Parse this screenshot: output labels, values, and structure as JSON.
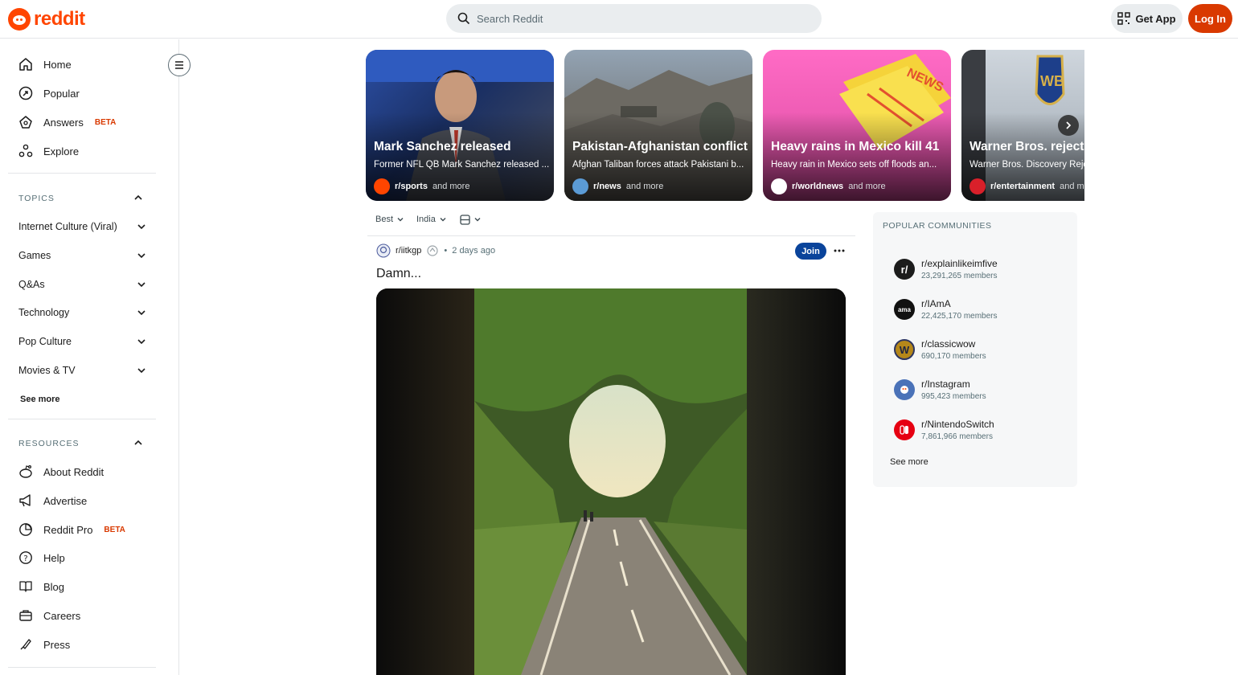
{
  "header": {
    "logo_text": "reddit",
    "search_placeholder": "Search Reddit",
    "get_app_label": "Get App",
    "login_label": "Log In"
  },
  "sidebar": {
    "nav": [
      {
        "label": "Home",
        "icon": "home-icon"
      },
      {
        "label": "Popular",
        "icon": "popular-icon"
      },
      {
        "label": "Answers",
        "icon": "answers-icon",
        "badge": "BETA"
      },
      {
        "label": "Explore",
        "icon": "explore-icon"
      }
    ],
    "topics_title": "TOPICS",
    "topics": [
      "Internet Culture (Viral)",
      "Games",
      "Q&As",
      "Technology",
      "Pop Culture",
      "Movies & TV"
    ],
    "topics_see_more": "See more",
    "resources_title": "RESOURCES",
    "resources": [
      {
        "label": "About Reddit",
        "icon": "reddit-alien-icon"
      },
      {
        "label": "Advertise",
        "icon": "megaphone-icon"
      },
      {
        "label": "Reddit Pro",
        "icon": "pro-icon",
        "badge": "BETA"
      },
      {
        "label": "Help",
        "icon": "help-icon"
      },
      {
        "label": "Blog",
        "icon": "blog-icon"
      },
      {
        "label": "Careers",
        "icon": "briefcase-icon"
      },
      {
        "label": "Press",
        "icon": "press-icon"
      }
    ]
  },
  "carousel": [
    {
      "title": "Mark Sanchez released",
      "desc": "Former NFL QB Mark Sanchez released ...",
      "sub": "r/sports",
      "more": "and more",
      "color": "#1f3a7a"
    },
    {
      "title": "Pakistan-Afghanistan conflict",
      "desc": "Afghan Taliban forces attack Pakistani b...",
      "sub": "r/news",
      "more": "and more",
      "color": "#6b7a87"
    },
    {
      "title": "Heavy rains in Mexico kill 41",
      "desc": "Heavy rain in Mexico sets off floods an...",
      "sub": "r/worldnews",
      "more": "and more",
      "color": "#e94fa8"
    },
    {
      "title": "Warner Bros. reject P",
      "desc": "Warner Bros. Discovery Reje",
      "sub": "r/entertainment",
      "more": "and mor",
      "color": "#b9c2cc"
    }
  ],
  "feed": {
    "sort": "Best",
    "location": "India",
    "post": {
      "subreddit": "r/iitkgp",
      "time": "2 days ago",
      "join_label": "Join",
      "title": "Damn..."
    }
  },
  "popular": {
    "title": "POPULAR COMMUNITIES",
    "communities": [
      {
        "name": "r/explainlikeimfive",
        "members": "23,291,265 members",
        "color": "#1c1c1c",
        "glyph": "r/"
      },
      {
        "name": "r/IAmA",
        "members": "22,425,170 members",
        "color": "#111111",
        "glyph": "ama"
      },
      {
        "name": "r/classicwow",
        "members": "690,170 members",
        "color": "#b5871a",
        "glyph": "W"
      },
      {
        "name": "r/Instagram",
        "members": "995,423 members",
        "color": "#4a72b8",
        "glyph": ""
      },
      {
        "name": "r/NintendoSwitch",
        "members": "7,861,966 members",
        "color": "#e60012",
        "glyph": ""
      }
    ],
    "see_more": "See more"
  }
}
